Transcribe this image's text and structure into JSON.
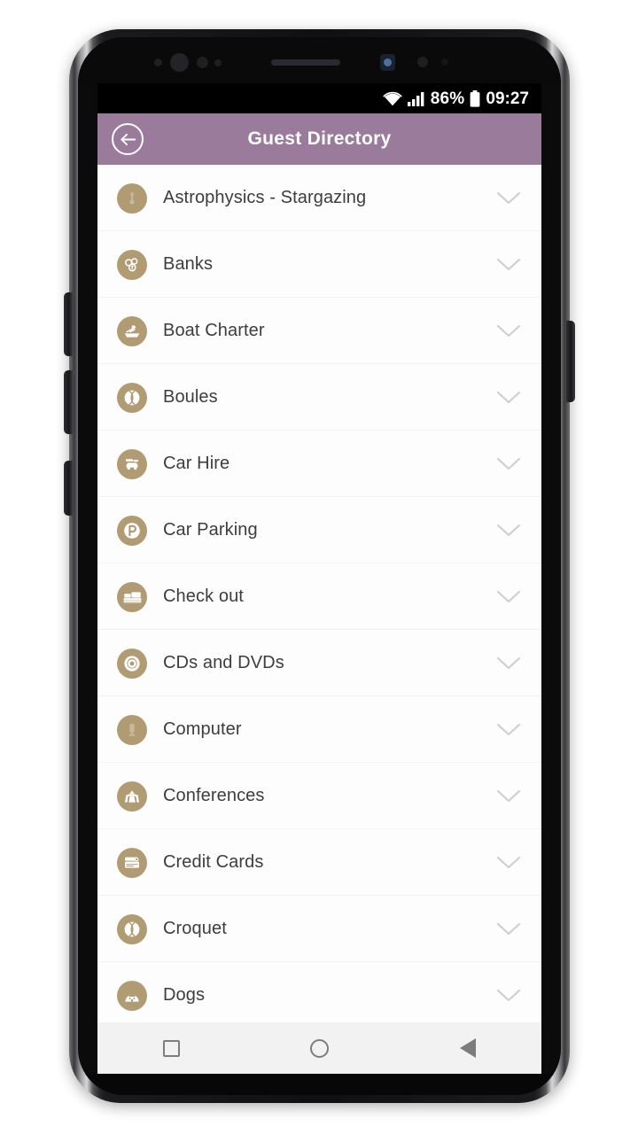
{
  "device": {
    "type": "android-phone",
    "frame_color": "#101012"
  },
  "status_bar": {
    "wifi_icon": "wifi-icon",
    "signal_icon": "cellular-signal-icon",
    "battery_percent": "86%",
    "battery_icon": "battery-icon",
    "clock": "09:27",
    "background": "#000000"
  },
  "app_bar": {
    "back_icon": "back-arrow-circle-icon",
    "title": "Guest Directory",
    "background": "#9b7b9c",
    "text_color": "#ffffff"
  },
  "list": {
    "icon_circle_color": "#b09b73",
    "chevron_icon": "chevron-down-icon",
    "items": [
      {
        "label": "Astrophysics - Stargazing",
        "icon": "telescope-icon",
        "faint": true
      },
      {
        "label": "Banks",
        "icon": "coins-icon",
        "faint": false
      },
      {
        "label": "Boat Charter",
        "icon": "rowing-boat-icon",
        "faint": false
      },
      {
        "label": "Boules",
        "icon": "ball-icon",
        "faint": false
      },
      {
        "label": "Car Hire",
        "icon": "car-icon",
        "faint": false
      },
      {
        "label": "Car Parking",
        "icon": "parking-p-icon",
        "faint": false
      },
      {
        "label": "Check out",
        "icon": "bed-icon",
        "faint": false
      },
      {
        "label": "CDs and DVDs",
        "icon": "compact-disc-icon",
        "faint": false
      },
      {
        "label": "Computer",
        "icon": "computer-icon",
        "faint": true
      },
      {
        "label": "Conferences",
        "icon": "lectern-icon",
        "faint": false
      },
      {
        "label": "Credit Cards",
        "icon": "credit-card-icon",
        "faint": false
      },
      {
        "label": "Croquet",
        "icon": "ball-icon",
        "faint": false
      },
      {
        "label": "Dogs",
        "icon": "dog-icon",
        "faint": false
      }
    ]
  },
  "nav_bar": {
    "recents_icon": "square-recents-icon",
    "home_icon": "circle-home-icon",
    "back_icon": "triangle-back-icon",
    "background": "#f2f2f2"
  }
}
